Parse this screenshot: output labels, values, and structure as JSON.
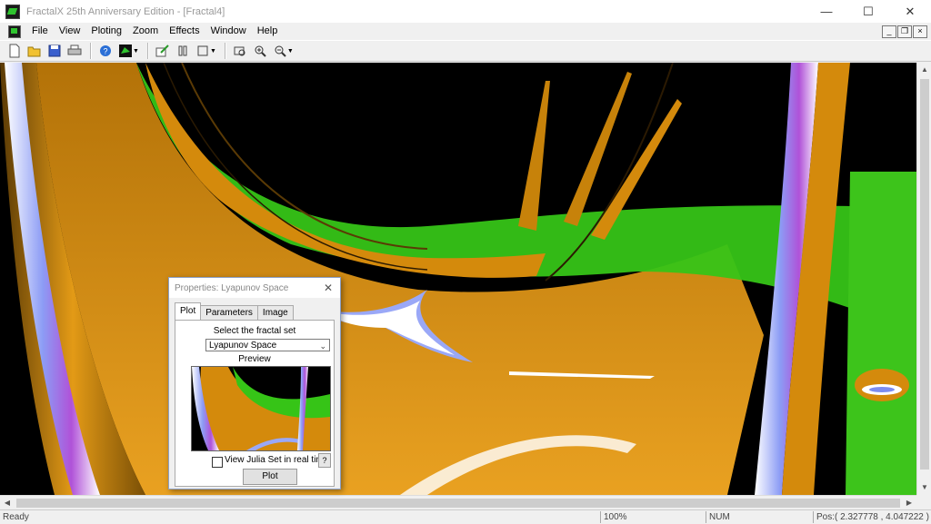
{
  "window": {
    "title": "FractalX 25th Anniversary Edition - [Fractal4]"
  },
  "menu": [
    "File",
    "View",
    "Ploting",
    "Zoom",
    "Effects",
    "Window",
    "Help"
  ],
  "toolbar": {
    "icons": [
      "new-icon",
      "open-icon",
      "save-icon",
      "print-icon",
      "help-icon",
      "fractal-icon",
      "plot-icon",
      "pause-icon",
      "stop-icon",
      "zoom-icon",
      "zoom-in-icon",
      "zoom-out-icon"
    ]
  },
  "dialog": {
    "title": "Properties: Lyapunov Space",
    "tabs": [
      "Plot",
      "Parameters",
      "Image"
    ],
    "select_label": "Select the fractal set",
    "selected_set": "Lyapunov Space",
    "preview_label": "Preview",
    "julia_label": "View Julia Set in real time",
    "help": "?",
    "plot_button": "Plot"
  },
  "status": {
    "ready": "Ready",
    "zoom": "100%",
    "num": "NUM",
    "pos": "Pos:( 2.327778 , 4.047222 )"
  },
  "colors": {
    "orange": "#d48a0c",
    "green": "#39c618",
    "blue": "#7c8cf0",
    "black": "#000000"
  }
}
